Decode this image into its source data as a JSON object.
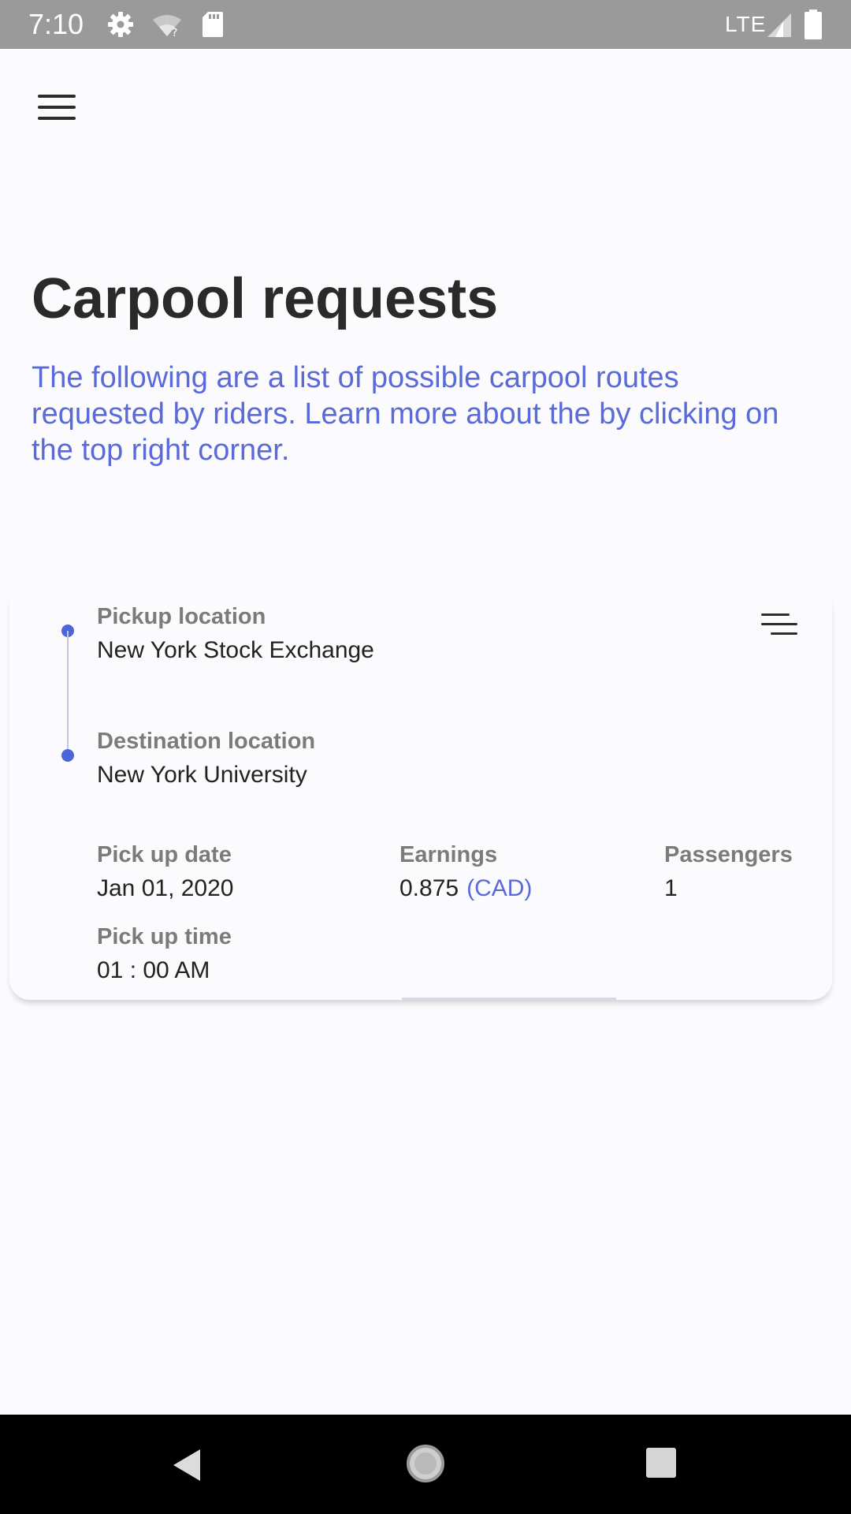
{
  "status_bar": {
    "time": "7:10",
    "network": "LTE",
    "icons": [
      "settings-icon",
      "wifi-icon",
      "sd-card-icon",
      "signal-icon",
      "battery-icon"
    ]
  },
  "header": {
    "menu_icon": "menu-icon"
  },
  "page": {
    "title": "Carpool requests",
    "description": "The following are a list of possible carpool routes requested by riders. Learn more about the by clicking on the top right corner."
  },
  "request_card": {
    "filter_icon": "filter-icon",
    "pickup": {
      "label": "Pickup location",
      "value": "New York Stock Exchange"
    },
    "destination": {
      "label": "Destination location",
      "value": "New York University"
    },
    "pickup_date": {
      "label": "Pick up date",
      "value": "Jan 01, 2020"
    },
    "earnings": {
      "label": "Earnings",
      "value": "0.875",
      "currency": "(CAD)"
    },
    "passengers": {
      "label": "Passengers",
      "value": "1"
    },
    "pickup_time": {
      "label": "Pick up time",
      "value": "01 : 00 AM"
    }
  },
  "nav_bar": {
    "icons": [
      "back-icon",
      "home-icon",
      "recents-icon"
    ]
  },
  "colors": {
    "accent": "#4a66d8",
    "link_text": "#5a6ad8",
    "background": "#fbfbfe",
    "status_bar": "#9a9a9a",
    "nav_bar": "#000000"
  }
}
